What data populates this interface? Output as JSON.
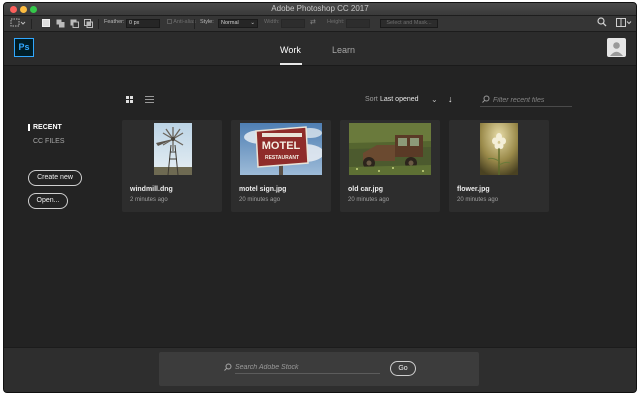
{
  "window": {
    "title": "Adobe Photoshop CC 2017"
  },
  "options_bar": {
    "feather_label": "Feather:",
    "feather_value": "0 px",
    "anti_alias_label": "Anti-alias",
    "style_label": "Style:",
    "style_value": "Normal",
    "width_label": "Width:",
    "height_label": "Height:",
    "select_mask_label": "Select and Mask..."
  },
  "header": {
    "logo": "Ps",
    "tabs": [
      {
        "label": "Work",
        "active": true
      },
      {
        "label": "Learn",
        "active": false
      }
    ]
  },
  "sidebar": {
    "recent_label": "RECENT",
    "cc_files_label": "CC FILES",
    "create_new_label": "Create new",
    "open_label": "Open..."
  },
  "toolbar": {
    "sort_label": "Sort",
    "sort_value": "Last opened",
    "filter_placeholder": "Filter recent files"
  },
  "recent_files": [
    {
      "name": "windmill.dng",
      "time": "2 minutes ago"
    },
    {
      "name": "motel sign.jpg",
      "time": "20 minutes ago"
    },
    {
      "name": "old car.jpg",
      "time": "20 minutes ago"
    },
    {
      "name": "flower.jpg",
      "time": "20 minutes ago"
    }
  ],
  "motel_sign_text": {
    "line1": "MOTEL",
    "line2": "RESTAURANT"
  },
  "stock": {
    "search_placeholder": "Search Adobe Stock",
    "go_label": "Go"
  },
  "colors": {
    "background": "#232323",
    "header": "#2b2b2b",
    "ps_accent": "#31a8ff",
    "card": "#2d2d2d"
  }
}
